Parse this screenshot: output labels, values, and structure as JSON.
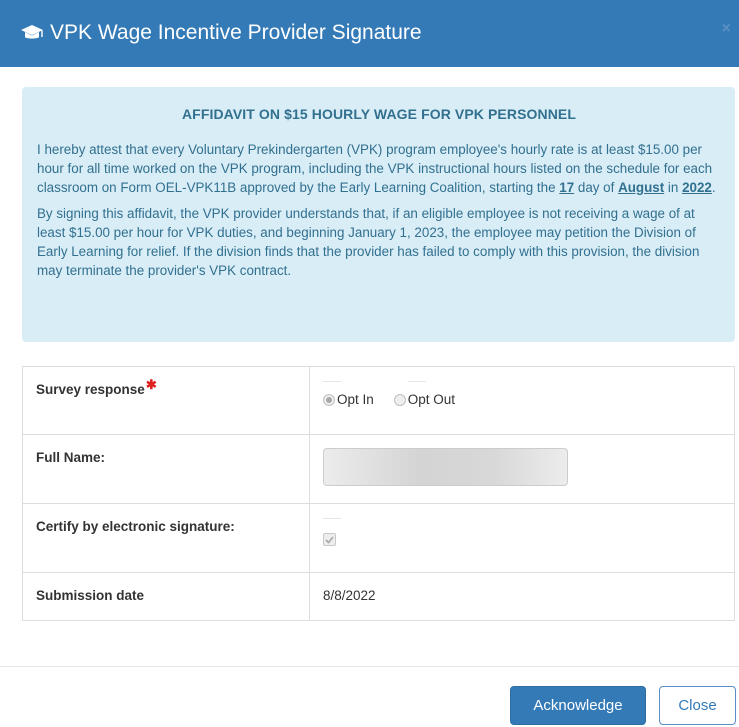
{
  "modal": {
    "title": "VPK Wage Incentive Provider Signature",
    "close_glyph": "×",
    "title_icon": "graduation-cap-icon"
  },
  "affidavit": {
    "heading": "AFFIDAVIT ON $15 HOURLY WAGE FOR VPK PERSONNEL",
    "p1_text": "I hereby attest that every Voluntary Prekindergarten (VPK) program employee's hourly rate is at least $15.00 per hour for all time worked on the VPK program, including the VPK instructional hours listed on the schedule for each classroom on Form OEL-VPK11B approved by the Early Learning Coalition, starting the ",
    "day": "17",
    "day_suffix": " day of ",
    "month": "August",
    "month_suffix": " in ",
    "year": "2022",
    "p1_end": ".",
    "p2_text": "By signing this affidavit, the VPK provider understands that, if an eligible employee is not receiving a wage of at least $15.00 per hour for VPK duties, and beginning January 1, 2023, the employee may petition the Division of Early Learning for relief. If the division finds that the provider has failed to comply with this provision, the division may terminate the provider's VPK contract."
  },
  "form": {
    "survey_label": "Survey response",
    "required_mark": "✱",
    "opt_in_label": "Opt In",
    "opt_out_label": "Opt Out",
    "selected": "Opt In",
    "full_name_label": "Full Name:",
    "certify_label": "Certify by electronic signature:",
    "certify_checked": true,
    "submission_label": "Submission date",
    "submission_date": "8/8/2022"
  },
  "footer": {
    "acknowledge_label": "Acknowledge",
    "close_label": "Close"
  },
  "colors": {
    "header_bg": "#337ab7",
    "alert_bg": "#d9edf7",
    "alert_text": "#31708f",
    "required": "#e02020"
  }
}
